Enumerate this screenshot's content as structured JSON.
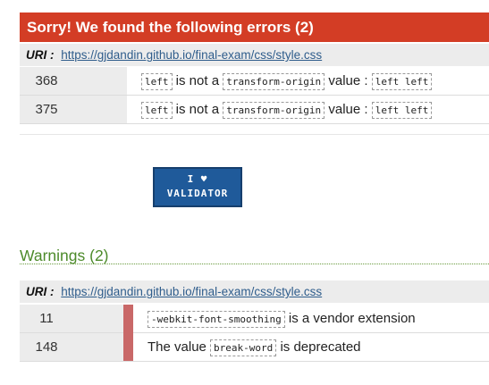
{
  "errors": {
    "title": "Sorry! We found the following errors (2)",
    "uri_label": "URI :",
    "uri": "https://gjdandin.github.io/final-exam/css/style.css",
    "rows": [
      {
        "line": "368",
        "prop": "left",
        "text_mid": "is not a",
        "type": "transform-origin",
        "text_val": "value :",
        "value": "left left"
      },
      {
        "line": "375",
        "prop": "left",
        "text_mid": "is not a",
        "type": "transform-origin",
        "text_val": "value :",
        "value": "left left"
      }
    ]
  },
  "badge": {
    "line1": "I ♥",
    "line2": "VALIDATOR"
  },
  "warnings": {
    "title": "Warnings (2)",
    "uri_label": "URI :",
    "uri": "https://gjdandin.github.io/final-exam/css/style.css",
    "rows": [
      {
        "line": "11",
        "code": "-webkit-font-smoothing",
        "suffix": "is a vendor extension"
      },
      {
        "line": "148",
        "prefix": "The value",
        "code": "break-word",
        "suffix": "is deprecated"
      }
    ]
  },
  "colors": {
    "error_header": "#d33d25",
    "warning_title": "#4c8a2a",
    "warning_bar": "#c96868",
    "badge_bg": "#1f5a9a",
    "link": "#2f5d8c"
  }
}
